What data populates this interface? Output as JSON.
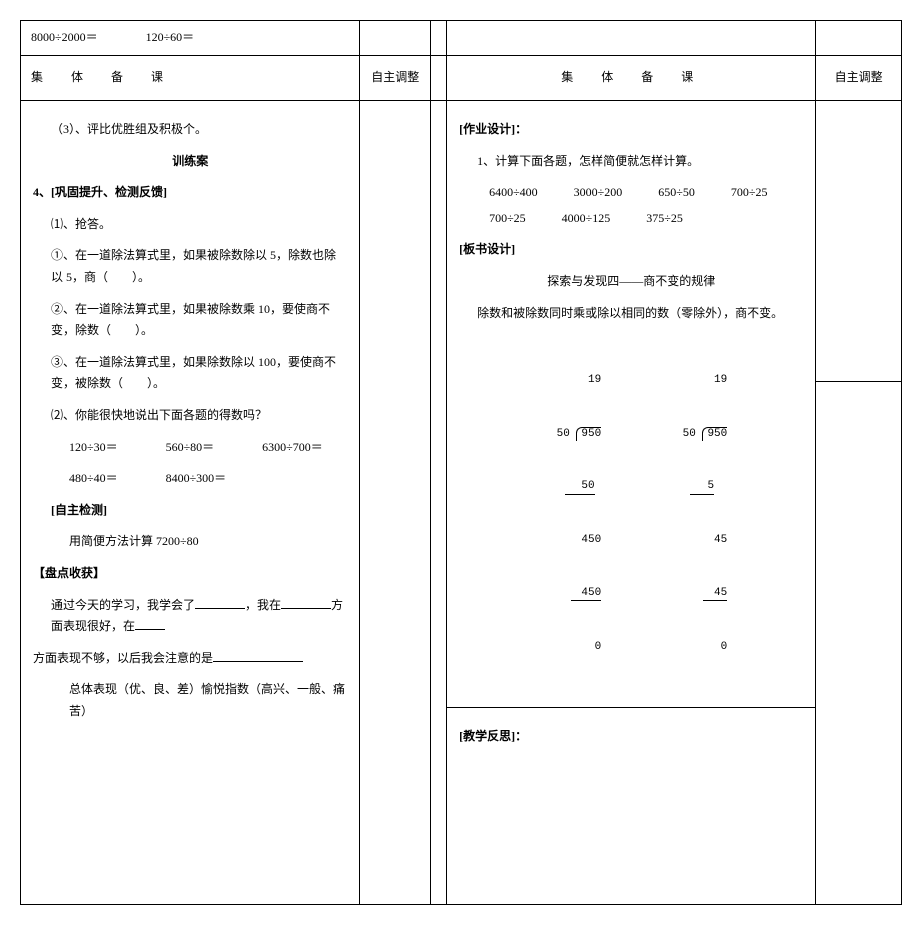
{
  "top_calc": "8000÷2000＝　　　　120÷60＝",
  "header_main": "集　体　备　课",
  "header_adj": "自主调整",
  "left": {
    "l1": "（3）、评比优胜组及积极个。",
    "train_title": "训练案",
    "sec4": "4、[巩固提升、检测反馈]",
    "q1": "⑴、抢答。",
    "q1_1": "①、在一道除法算式里，如果被除数除以 5，除数也除以 5，商（　　）。",
    "q1_2": "②、在一道除法算式里，如果被除数乘 10，要使商不变，除数（　　）。",
    "q1_3": "③、在一道除法算式里，如果除数除以 100，要使商不变，被除数（　　）。",
    "q2": "⑵、你能很快地说出下面各题的得数吗？",
    "q2_row1": "120÷30＝　　　　560÷80＝　　　　6300÷700＝",
    "q2_row2": "480÷40＝　　　　8400÷300＝",
    "self_test": "[自主检测]",
    "self_test_q": "用简便方法计算 7200÷80",
    "pan_dian": "【盘点收获】",
    "summary1_a": "通过今天的学习，我学会了",
    "summary1_b": "，我在",
    "summary1_c": "方面表现很好，在",
    "summary2_a": "方面表现不够，以后我会注意的是",
    "summary3": "总体表现（优、良、差）愉悦指数（高兴、一般、痛苦）"
  },
  "right": {
    "hw_title": "[作业设计]：",
    "hw_line1": "1、计算下面各题，怎样简便就怎样计算。",
    "hw_row1": "6400÷400　　　3000÷200　　　650÷50　　　700÷25",
    "hw_row2": "700÷25　　　4000÷125　　　375÷25",
    "board_title": "[板书设计]",
    "board_heading": "探索与发现四——商不变的规律",
    "board_rule": "除数和被除数同时乘或除以相同的数（零除外），商不变。",
    "ld": {
      "left": {
        "q": "19",
        "divisor": "50",
        "dividend": "950",
        "s1": "50",
        "r1": "450",
        "s2": "450",
        "rem": "0"
      },
      "right": {
        "q": "19",
        "divisor": "50",
        "dividend": "950",
        "s1": "5",
        "r1": "45",
        "s2": "45",
        "rem": "0"
      }
    },
    "reflect_title": "[教学反思]："
  }
}
